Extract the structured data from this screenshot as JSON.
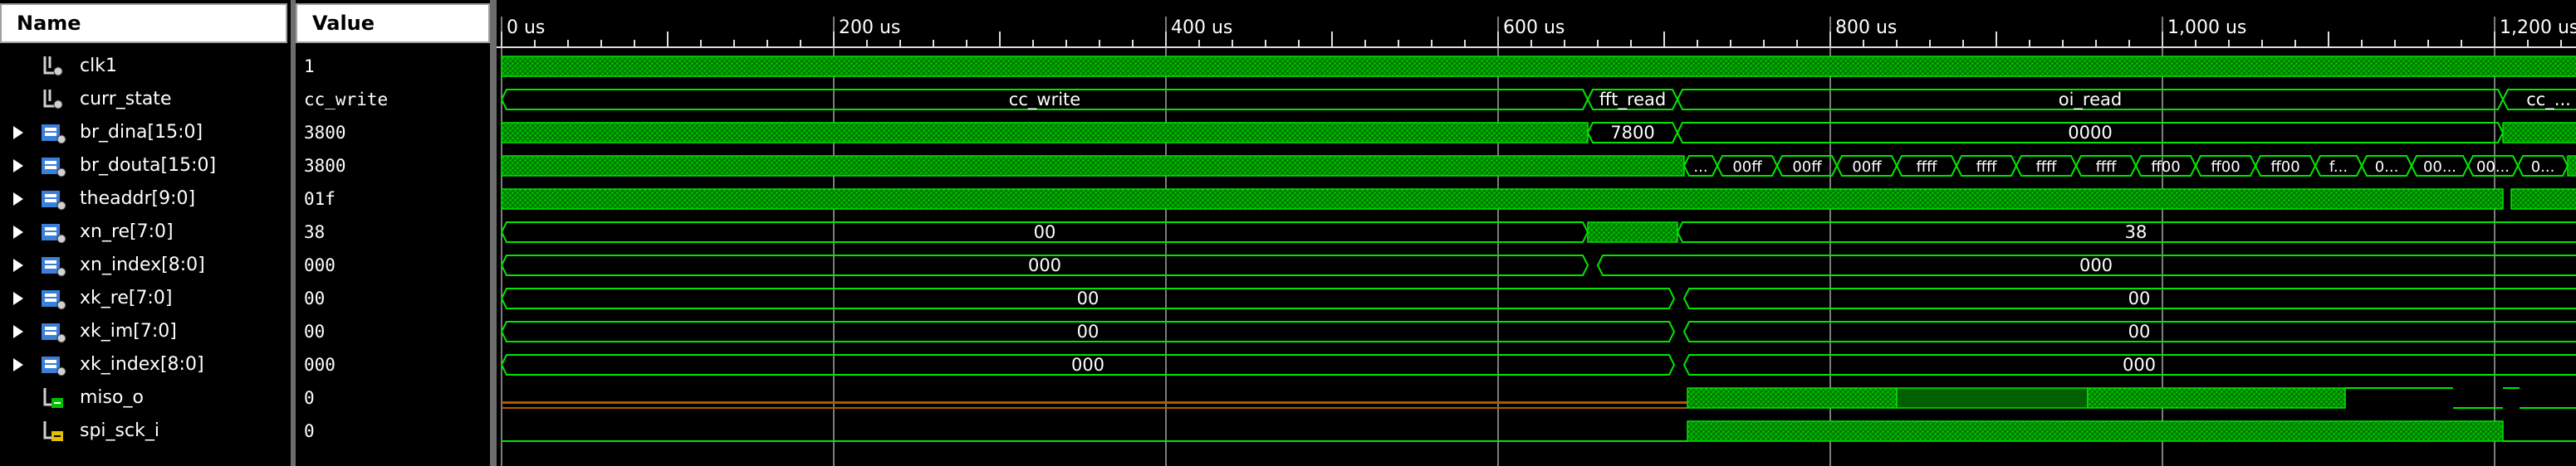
{
  "columns": {
    "name": "Name",
    "value": "Value"
  },
  "signals": [
    {
      "name": "clk1",
      "value": "1",
      "kind": "bit",
      "expandable": false
    },
    {
      "name": "curr_state",
      "value": "cc_write",
      "kind": "bit",
      "expandable": false
    },
    {
      "name": "br_dina[15:0]",
      "value": "3800",
      "kind": "bus",
      "expandable": true
    },
    {
      "name": "br_douta[15:0]",
      "value": "3800",
      "kind": "bus",
      "expandable": true
    },
    {
      "name": "theaddr[9:0]",
      "value": "01f",
      "kind": "bus",
      "expandable": true
    },
    {
      "name": "xn_re[7:0]",
      "value": "38",
      "kind": "bus",
      "expandable": true
    },
    {
      "name": "xn_index[8:0]",
      "value": "000",
      "kind": "bus",
      "expandable": true
    },
    {
      "name": "xk_re[7:0]",
      "value": "00",
      "kind": "bus",
      "expandable": true
    },
    {
      "name": "xk_im[7:0]",
      "value": "00",
      "kind": "bus",
      "expandable": true
    },
    {
      "name": "xk_index[8:0]",
      "value": "000",
      "kind": "bus",
      "expandable": true
    },
    {
      "name": "miso_o",
      "value": "0",
      "kind": "out",
      "expandable": false
    },
    {
      "name": "spi_sck_i",
      "value": "0",
      "kind": "in",
      "expandable": false
    }
  ],
  "time_axis": {
    "labels": [
      "0 us",
      "200 us",
      "400 us",
      "600 us",
      "800 us",
      "1,000 us",
      "1,200 us"
    ]
  },
  "wave_labels": {
    "curr_state": [
      "cc_write",
      "fft_read",
      "oi_read",
      "cc_..."
    ],
    "br_dina": [
      "7800",
      "0000"
    ],
    "br_douta": [
      "...",
      "00ff",
      "00ff",
      "00ff",
      "ffff",
      "ffff",
      "ffff",
      "ffff",
      "ff00",
      "ff00",
      "ff00",
      "f...",
      "0...",
      "00...",
      "00...",
      "0..."
    ],
    "xn_re": [
      "00",
      "38"
    ],
    "xn_index": [
      "000",
      "000"
    ],
    "xk_re": [
      "00",
      "00"
    ],
    "xk_im": [
      "00",
      "00"
    ],
    "xk_index": [
      "000",
      "000"
    ]
  },
  "colors": {
    "wave": "#00e600",
    "dense": "#008a00",
    "undefined_line": "#b05a00",
    "background": "#000000"
  },
  "icons": {
    "bit": "bit-signal-icon",
    "bus": "bus-signal-icon",
    "out": "output-port-icon",
    "in": "input-port-icon"
  }
}
